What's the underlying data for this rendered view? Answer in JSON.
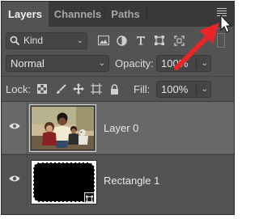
{
  "tabs": [
    {
      "label": "Layers",
      "active": true
    },
    {
      "label": "Channels",
      "active": false
    },
    {
      "label": "Paths",
      "active": false
    }
  ],
  "panel_menu": {
    "icon": "hamburger-menu-icon"
  },
  "filter": {
    "kind_label": "Kind",
    "icons": [
      "image-filter-icon",
      "adjustment-filter-icon",
      "type-filter-icon",
      "shape-filter-icon",
      "smart-object-filter-icon"
    ]
  },
  "blend": {
    "mode": "Normal",
    "opacity_label": "Opacity:",
    "opacity_value": "100%"
  },
  "lock": {
    "label": "Lock:",
    "icons": [
      "lock-transparent-pixels-icon",
      "lock-image-pixels-icon",
      "lock-position-icon",
      "lock-artboard-icon",
      "lock-all-icon"
    ],
    "fill_label": "Fill:",
    "fill_value": "100%"
  },
  "layers": [
    {
      "name": "Layer 0",
      "selected": true,
      "visible": true,
      "type": "photo"
    },
    {
      "name": "Rectangle 1",
      "selected": false,
      "visible": true,
      "type": "shape"
    }
  ],
  "colors": {
    "panel_bg": "#535353",
    "selected_row": "#686868",
    "annotation_arrow": "#e8262a"
  }
}
